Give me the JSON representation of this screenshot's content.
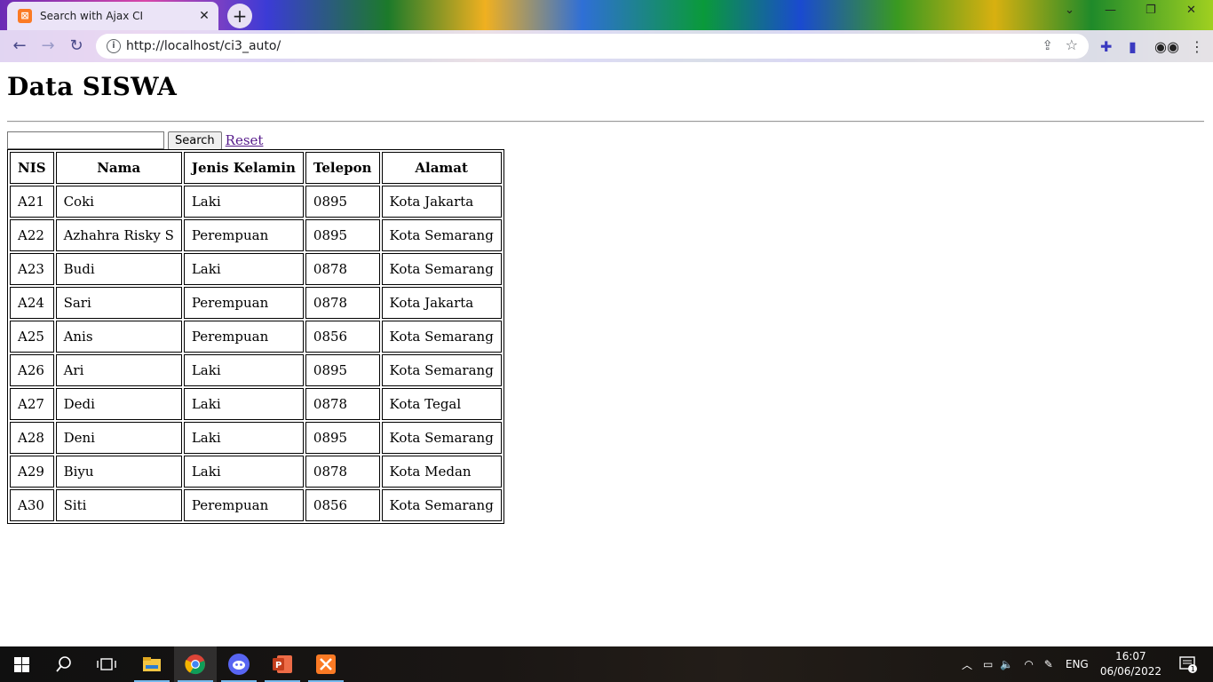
{
  "browser": {
    "tab_title": "Search with Ajax CI",
    "tab_close": "✕",
    "new_tab": "+",
    "url": "http://localhost/ci3_auto/"
  },
  "page": {
    "heading": "Data SISWA",
    "search": {
      "value": "",
      "placeholder": "",
      "button_label": "Search",
      "reset_label": "Reset"
    },
    "table": {
      "headers": [
        "NIS",
        "Nama",
        "Jenis Kelamin",
        "Telepon",
        "Alamat"
      ],
      "rows": [
        [
          "A21",
          "Coki",
          "Laki",
          "0895",
          "Kota Jakarta"
        ],
        [
          "A22",
          "Azhahra Risky S",
          "Perempuan",
          "0895",
          "Kota Semarang"
        ],
        [
          "A23",
          "Budi",
          "Laki",
          "0878",
          "Kota Semarang"
        ],
        [
          "A24",
          "Sari",
          "Perempuan",
          "0878",
          "Kota Jakarta"
        ],
        [
          "A25",
          "Anis",
          "Perempuan",
          "0856",
          "Kota Semarang"
        ],
        [
          "A26",
          "Ari",
          "Laki",
          "0895",
          "Kota Semarang"
        ],
        [
          "A27",
          "Dedi",
          "Laki",
          "0878",
          "Kota Tegal"
        ],
        [
          "A28",
          "Deni",
          "Laki",
          "0895",
          "Kota Semarang"
        ],
        [
          "A29",
          "Biyu",
          "Laki",
          "0878",
          "Kota Medan"
        ],
        [
          "A30",
          "Siti",
          "Perempuan",
          "0856",
          "Kota Semarang"
        ]
      ]
    }
  },
  "taskbar": {
    "language": "ENG",
    "time": "16:07",
    "date": "06/06/2022",
    "notification_count": "1"
  },
  "colors": {
    "link": "#551a8b",
    "taskbar_active": "#76b9ed"
  }
}
